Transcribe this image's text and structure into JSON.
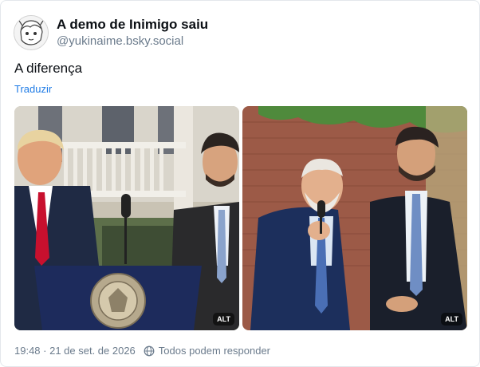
{
  "post": {
    "author_name": "A demo de Inimigo saiu",
    "author_handle": "@yukinaime.bsky.social",
    "text": "A diferença",
    "translate_label": "Traduzir",
    "timestamp": "19:48 · 21 de set. de 2026",
    "reply_setting": "Todos podem responder"
  },
  "media": {
    "alt_badge_left": "ALT",
    "alt_badge_right": "ALT"
  },
  "icons": {
    "avatar": "anime-avatar",
    "reply_setting": "globe-icon"
  }
}
